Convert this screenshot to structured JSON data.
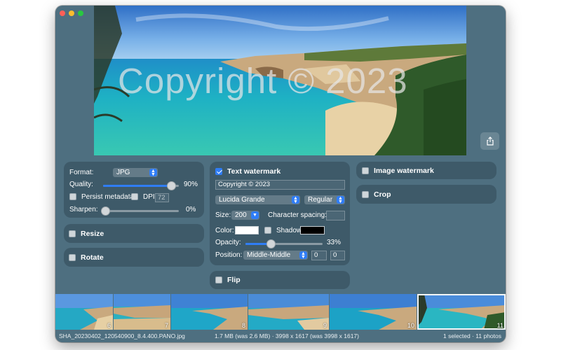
{
  "preview": {
    "watermark_text": "Copyright © 2023"
  },
  "format_panel": {
    "format_label": "Format:",
    "format_value": "JPG",
    "quality_label": "Quality:",
    "quality_value": "90%",
    "quality_level": 0.9,
    "persist_metadata_label": "Persist metadata",
    "dpi_label": "DPI",
    "dpi_value": "72",
    "sharpen_label": "Sharpen:",
    "sharpen_value": "0%",
    "sharpen_level": 0
  },
  "resize_panel": {
    "label": "Resize"
  },
  "rotate_panel": {
    "label": "Rotate"
  },
  "text_watermark": {
    "label": "Text watermark",
    "enabled": true,
    "text_value": "Copyright © 2023",
    "font_value": "Lucida Grande",
    "style_value": "Regular",
    "size_label": "Size:",
    "size_value": "200",
    "char_spacing_label": "Character spacing:",
    "color_label": "Color:",
    "color_value": "#ffffff",
    "shadow_label": "Shadow:",
    "shadow_color": "#000000",
    "opacity_label": "Opacity:",
    "opacity_value": "33%",
    "opacity_level": 0.33,
    "position_label": "Position:",
    "position_value": "Middle-Middle",
    "offset_x": "0",
    "offset_y": "0"
  },
  "flip_panel": {
    "label": "Flip"
  },
  "image_watermark_panel": {
    "label": "Image watermark"
  },
  "crop_panel": {
    "label": "Crop"
  },
  "filmstrip": {
    "thumbnails": [
      {
        "number": "6"
      },
      {
        "number": "7"
      },
      {
        "number": "8"
      },
      {
        "number": "9"
      },
      {
        "number": "10"
      },
      {
        "number": "11",
        "selected": true
      }
    ]
  },
  "status_bar": {
    "filename": "SHA_20230402_120540900_8.4.400.PANO.jpg",
    "size_info": "1.7 MB (was 2.6 MB) · 3998 x 1617 (was 3998 x 1617)",
    "selection_info": "1 selected · 11 photos"
  },
  "colors": {
    "window_bg": "#4e6f80",
    "panel_bg": "#3e5a69",
    "accent": "#2f7df6"
  }
}
